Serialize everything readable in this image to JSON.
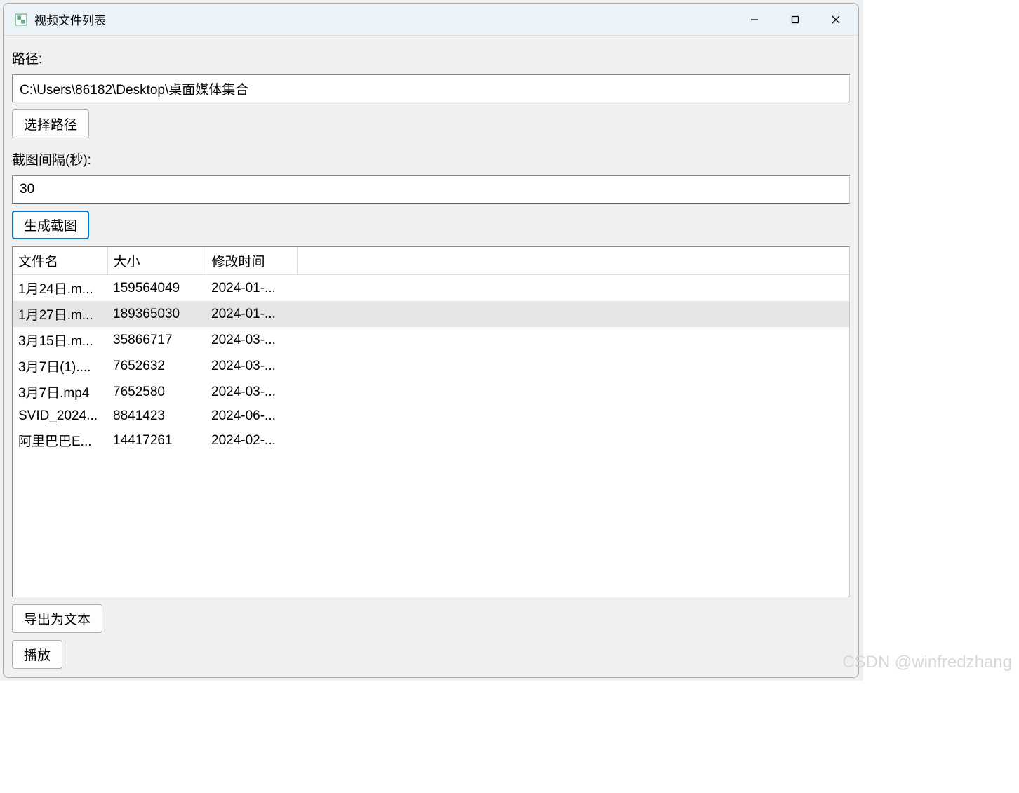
{
  "window": {
    "title": "视频文件列表"
  },
  "labels": {
    "path": "路径:",
    "interval": "截图间隔(秒):"
  },
  "inputs": {
    "path_value": "C:\\Users\\86182\\Desktop\\桌面媒体集合",
    "interval_value": "30"
  },
  "buttons": {
    "select_path": "选择路径",
    "generate": "生成截图",
    "export_text": "导出为文本",
    "play": "播放"
  },
  "table": {
    "headers": {
      "filename": "文件名",
      "size": "大小",
      "modified": "修改时间"
    },
    "rows": [
      {
        "filename": "1月24日.m...",
        "size": "159564049",
        "modified": "2024-01-...",
        "selected": false
      },
      {
        "filename": "1月27日.m...",
        "size": "189365030",
        "modified": "2024-01-...",
        "selected": true
      },
      {
        "filename": "3月15日.m...",
        "size": "35866717",
        "modified": "2024-03-...",
        "selected": false
      },
      {
        "filename": "3月7日(1)....",
        "size": "7652632",
        "modified": "2024-03-...",
        "selected": false
      },
      {
        "filename": "3月7日.mp4",
        "size": "7652580",
        "modified": "2024-03-...",
        "selected": false
      },
      {
        "filename": "SVID_2024...",
        "size": "8841423",
        "modified": "2024-06-...",
        "selected": false
      },
      {
        "filename": "阿里巴巴E...",
        "size": "14417261",
        "modified": "2024-02-...",
        "selected": false
      }
    ]
  },
  "watermark": "CSDN @winfredzhang"
}
